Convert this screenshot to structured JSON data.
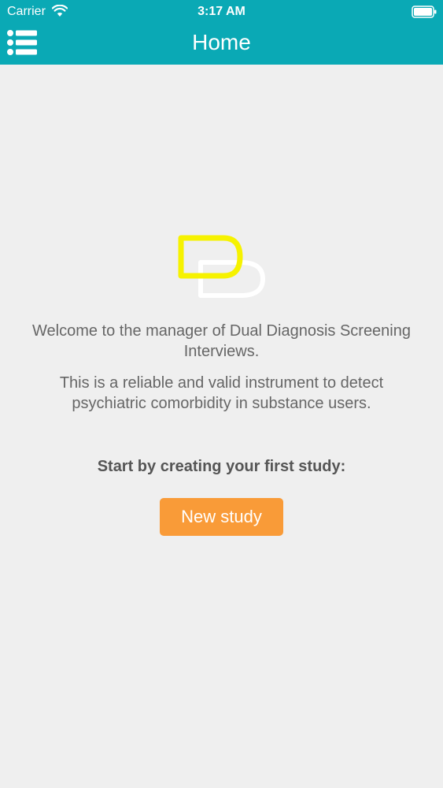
{
  "status_bar": {
    "carrier": "Carrier",
    "time": "3:17 AM"
  },
  "nav": {
    "title": "Home",
    "menu_icon": "list-menu-icon"
  },
  "main": {
    "welcome_text": "Welcome to the manager of Dual Diagnosis Screening Interviews.",
    "description_text": "This is a reliable and valid instrument to detect psychiatric comorbidity in substance users.",
    "prompt_text": "Start by creating your first study:",
    "new_study_label": "New study"
  },
  "colors": {
    "header": "#0aa9b5",
    "background": "#efefef",
    "accent_button": "#f99b38",
    "logo_yellow": "#f6f200",
    "text": "#666666"
  }
}
